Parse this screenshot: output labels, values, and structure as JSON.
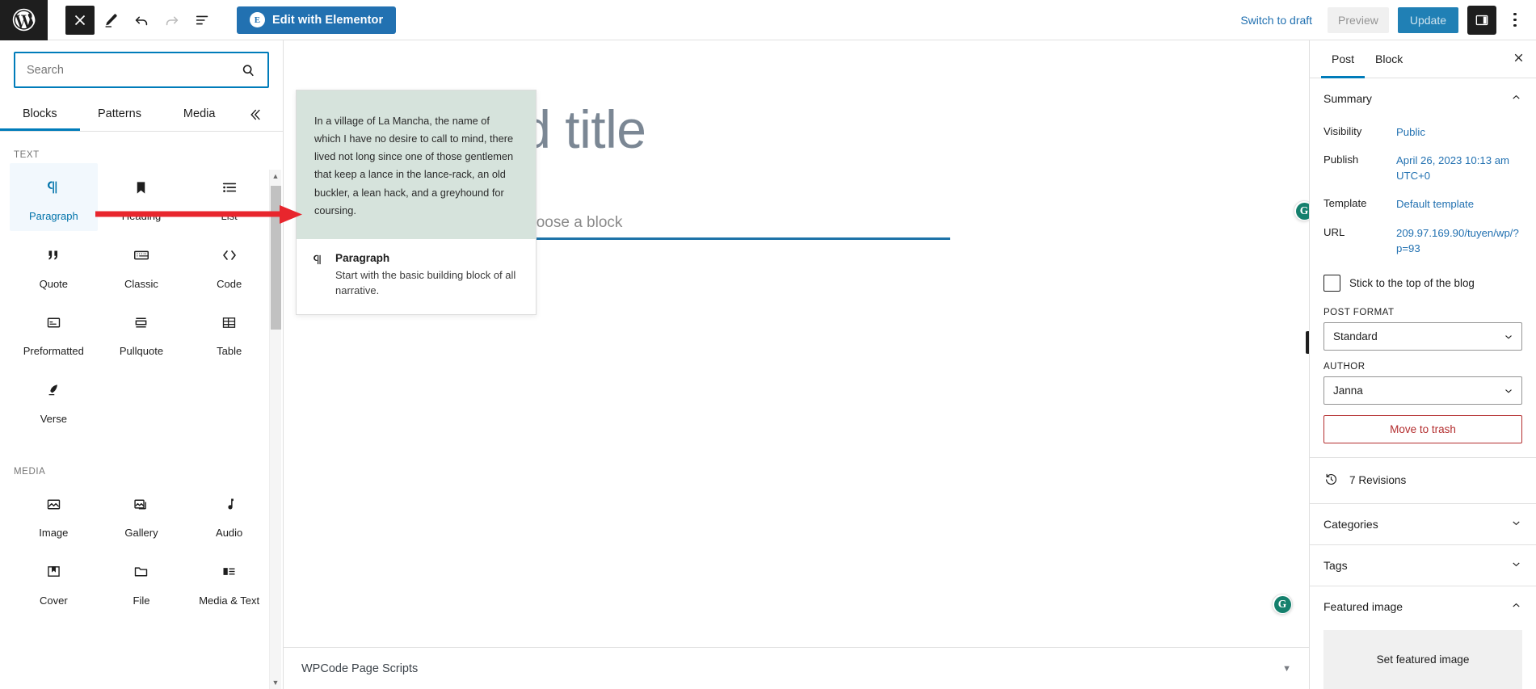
{
  "header": {
    "logo_icon": "wordpress-logo-icon",
    "close_icon": "close-icon",
    "edit_icon": "pencil-icon",
    "undo_icon": "undo-icon",
    "redo_icon": "redo-icon",
    "list_view_icon": "list-view-icon",
    "elementor_button": "Edit with Elementor",
    "elementor_badge": "E",
    "switch_to_draft": "Switch to draft",
    "preview": "Preview",
    "update": "Update",
    "settings_toggle_icon": "sidebar-toggle-icon",
    "options_icon": "kebab-menu-icon"
  },
  "inserter": {
    "search": {
      "value": "",
      "placeholder": "Search",
      "icon": "search-icon"
    },
    "tabs": [
      {
        "label": "Blocks",
        "active": true
      },
      {
        "label": "Patterns",
        "active": false
      },
      {
        "label": "Media",
        "active": false
      }
    ],
    "tab_extra_icon": "block-preview-toggle-icon",
    "sections": [
      {
        "label": "TEXT",
        "blocks": [
          {
            "label": "Paragraph",
            "icon": "pilcrow-icon",
            "selected": true
          },
          {
            "label": "Heading",
            "icon": "bookmark-icon",
            "selected": false
          },
          {
            "label": "List",
            "icon": "list-icon",
            "selected": false
          },
          {
            "label": "Quote",
            "icon": "quote-icon",
            "selected": false
          },
          {
            "label": "Classic",
            "icon": "keyboard-icon",
            "selected": false
          },
          {
            "label": "Code",
            "icon": "code-brackets-icon",
            "selected": false
          },
          {
            "label": "Preformatted",
            "icon": "preformatted-icon",
            "selected": false
          },
          {
            "label": "Pullquote",
            "icon": "pullquote-icon",
            "selected": false
          },
          {
            "label": "Table",
            "icon": "table-icon",
            "selected": false
          },
          {
            "label": "Verse",
            "icon": "quill-icon",
            "selected": false
          }
        ]
      },
      {
        "label": "MEDIA",
        "blocks": [
          {
            "label": "Image",
            "icon": "image-icon",
            "selected": false
          },
          {
            "label": "Gallery",
            "icon": "gallery-icon",
            "selected": false
          },
          {
            "label": "Audio",
            "icon": "music-note-icon",
            "selected": false
          },
          {
            "label": "Cover",
            "icon": "cover-icon",
            "selected": false
          },
          {
            "label": "File",
            "icon": "folder-icon",
            "selected": false
          },
          {
            "label": "Media & Text",
            "icon": "media-text-icon",
            "selected": false
          }
        ]
      }
    ],
    "scrollbar": {
      "up_icon": "scroll-up-arrow-icon",
      "down_icon": "scroll-down-arrow-icon"
    }
  },
  "block_preview": {
    "sample_text": "In a village of La Mancha, the name of which I have no desire to call to mind, there lived not long since one of those gentlemen that keep a lance in the lance-rack, an old buckler, a lean hack, and a greyhound for coursing.",
    "icon": "pilcrow-icon",
    "title": "Paragraph",
    "description": "Start with the basic building block of all narrative.",
    "background_color": "#d6e3dc"
  },
  "annotation": {
    "arrow_color": "#e8262d",
    "icon": "red-arrow-icon"
  },
  "editor": {
    "title_placeholder": "Add title",
    "block_placeholder": "Type / to choose a block",
    "add_block_label": "+",
    "grammarly_letter": "G",
    "grammarly_color": "#15806d"
  },
  "bottom_bar": {
    "title": "WPCode Page Scripts",
    "chevron_icon": "chevron-down-icon"
  },
  "settings": {
    "tabs": [
      {
        "label": "Post",
        "active": true
      },
      {
        "label": "Block",
        "active": false
      }
    ],
    "close_icon": "close-icon",
    "summary": {
      "title": "Summary",
      "chevron_icon": "chevron-up-icon",
      "rows": [
        {
          "key": "Visibility",
          "value": "Public"
        },
        {
          "key": "Publish",
          "value": "April 26, 2023 10:13 am UTC+0"
        },
        {
          "key": "Template",
          "value": "Default template"
        },
        {
          "key": "URL",
          "value": "209.97.169.90/tuyen/wp/?p=93"
        }
      ],
      "sticky_label": "Stick to the top of the blog",
      "sticky_checked": false,
      "post_format_label": "POST FORMAT",
      "post_format_value": "Standard",
      "author_label": "AUTHOR",
      "author_value": "Janna",
      "trash_label": "Move to trash"
    },
    "revisions": {
      "label": "7 Revisions",
      "icon": "history-clock-icon"
    },
    "categories": {
      "label": "Categories",
      "chevron_icon": "chevron-down-icon"
    },
    "tags": {
      "label": "Tags",
      "chevron_icon": "chevron-down-icon"
    },
    "featured_image": {
      "label": "Featured image",
      "chevron_icon": "chevron-up-icon",
      "button_label": "Set featured image"
    }
  }
}
